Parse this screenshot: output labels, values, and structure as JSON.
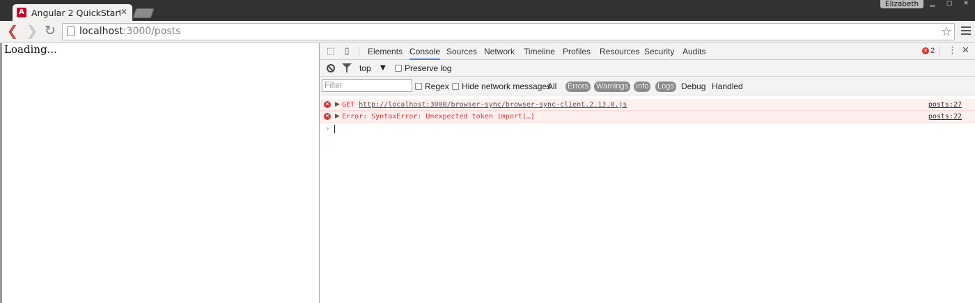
{
  "window": {
    "tab_title": "Angular 2 QuickStart",
    "tab_favicon": "angular-logo-icon",
    "profile_name": "Elizabeth",
    "controls": [
      "minimize-icon",
      "maximize-icon",
      "close-icon"
    ]
  },
  "toolbar": {
    "url_host": "localhost",
    "url_rest": ":3000/posts",
    "icons": [
      "back-arrow-icon",
      "forward-arrow-icon",
      "reload-icon",
      "page-icon",
      "bookmark-star-icon",
      "menu-icon"
    ]
  },
  "page": {
    "loading_text": "Loading..."
  },
  "devtools": {
    "tabs": [
      "Elements",
      "Console",
      "Sources",
      "Network",
      "Timeline",
      "Profiles",
      "Resources",
      "Security",
      "Audits"
    ],
    "active_tab": "Console",
    "error_count": "2",
    "context": "top",
    "preserve_log_label": "Preserve log",
    "filter_placeholder": "Filter",
    "regex_label": "Regex",
    "hide_network_label": "Hide network messages",
    "levels": {
      "all": "All",
      "errors": "Errors",
      "warnings": "Warnings",
      "info": "Info",
      "logs": "Logs",
      "debug": "Debug",
      "handled": "Handled"
    },
    "messages": [
      {
        "method": "GET",
        "url": "http://localhost:3000/browser-sync/browser-sync-client.2.13.0.js",
        "source": "posts:27"
      },
      {
        "text": "Error: SyntaxError: Unexpected token import(…)",
        "source": "posts:22"
      }
    ],
    "prompt": "›",
    "colors": {
      "error": "#d9302c",
      "error_bg": "#fff0f0",
      "active_tab_underline": "#3e82f7"
    }
  }
}
